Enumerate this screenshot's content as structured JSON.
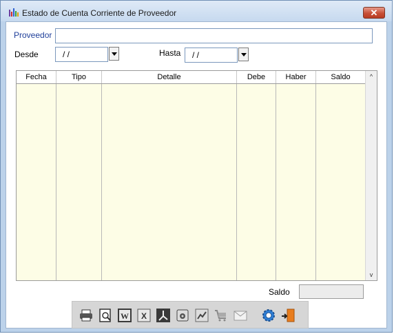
{
  "window": {
    "title": "Estado de Cuenta Corriente de Proveedor"
  },
  "form": {
    "proveedor_label": "Proveedor",
    "proveedor_value": "",
    "desde_label": "Desde",
    "desde_value": " /  /",
    "hasta_label": "Hasta",
    "hasta_value": " /  /"
  },
  "grid": {
    "columns": [
      "Fecha",
      "Tipo",
      "Detalle",
      "Debe",
      "Haber",
      "Saldo"
    ],
    "rows": []
  },
  "footer": {
    "saldo_label": "Saldo",
    "saldo_value": ""
  },
  "toolbar": {
    "buttons": [
      "print-icon",
      "preview-icon",
      "word-icon",
      "excel-icon",
      "pdf-icon",
      "disk-icon",
      "chart-icon",
      "cart-icon",
      "mail-icon",
      "settings-icon",
      "exit-icon"
    ]
  }
}
